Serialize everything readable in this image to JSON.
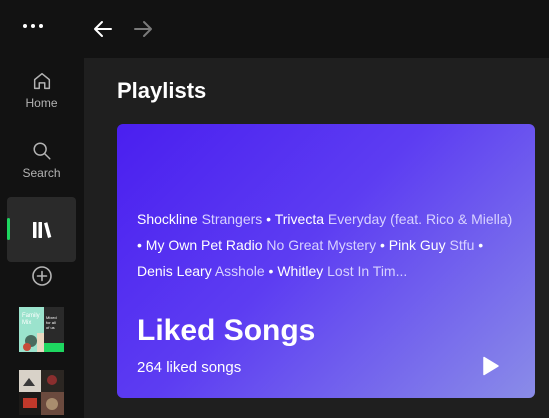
{
  "topbar": {
    "menu_icon": "more-horizontal-icon",
    "back_icon": "arrow-left-icon",
    "forward_icon": "arrow-right-icon"
  },
  "sidebar": {
    "items": [
      {
        "label": "Home",
        "icon": "home-icon"
      },
      {
        "label": "Search",
        "icon": "search-icon"
      },
      {
        "label": "",
        "icon": "library-icon",
        "active": true
      },
      {
        "label": "",
        "icon": "add-circle-icon"
      }
    ],
    "thumbnails": [
      {
        "caption_lines": [
          "Family",
          "Mix"
        ],
        "side_lines": [
          "Mixed",
          "for all",
          "of us"
        ]
      },
      {
        "caption_lines": []
      }
    ]
  },
  "main": {
    "title": "Playlists",
    "liked_songs": {
      "preview": [
        {
          "artist": "Shockline",
          "track": "Strangers"
        },
        {
          "artist": "Trivecta",
          "track": "Everyday (feat. Rico & Miella)"
        },
        {
          "artist": "My Own Pet Radio",
          "track": "No Great Mystery"
        },
        {
          "artist": "Pink Guy",
          "track": "Stfu"
        },
        {
          "artist": "Denis Leary",
          "track": "Asshole"
        },
        {
          "artist": "Whitley",
          "track": "Lost In Tim..."
        }
      ],
      "separator": " • ",
      "title": "Liked Songs",
      "count": "264 liked songs",
      "play_icon": "play-icon"
    }
  },
  "colors": {
    "background": "#121212",
    "main_background": "#1f1f1f",
    "accent": "#1ed760",
    "card_gradient_start": "#4a1ff0",
    "card_gradient_end": "#8a8ce8"
  }
}
